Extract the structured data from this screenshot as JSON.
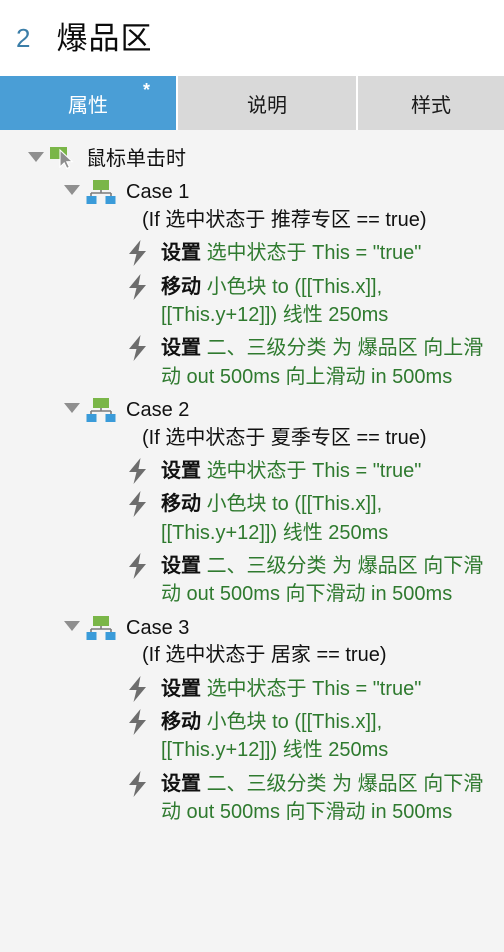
{
  "header": {
    "index": "2",
    "title": "爆品区"
  },
  "tabs": [
    {
      "label": "属性",
      "active": true,
      "dirty_marker": "*"
    },
    {
      "label": "说明",
      "active": false,
      "dirty_marker": ""
    },
    {
      "label": "样式",
      "active": false,
      "dirty_marker": ""
    }
  ],
  "tree": {
    "root": {
      "icon": "mouse-click-icon",
      "label": "鼠标单击时",
      "expanded": true
    },
    "cases": [
      {
        "icon": "case-branch-icon",
        "title": "Case 1",
        "condition": "(If 选中状态于 推荐专区 == true)",
        "expanded": true,
        "actions": [
          {
            "icon": "lightning-icon",
            "verb": "设置",
            "param": "选中状态于 This = \"true\""
          },
          {
            "icon": "lightning-icon",
            "verb": "移动",
            "param": "小色块 to ([[This.x]], [[This.y+12]]) 线性 250ms"
          },
          {
            "icon": "lightning-icon",
            "verb": "设置",
            "param": "二、三级分类 为 爆品区 向上滑动 out 500ms 向上滑动 in 500ms"
          }
        ]
      },
      {
        "icon": "case-branch-icon",
        "title": "Case 2",
        "condition": "(If 选中状态于 夏季专区 == true)",
        "expanded": true,
        "actions": [
          {
            "icon": "lightning-icon",
            "verb": "设置",
            "param": "选中状态于 This = \"true\""
          },
          {
            "icon": "lightning-icon",
            "verb": "移动",
            "param": "小色块 to ([[This.x]], [[This.y+12]]) 线性 250ms"
          },
          {
            "icon": "lightning-icon",
            "verb": "设置",
            "param": "二、三级分类 为 爆品区 向下滑动 out 500ms 向下滑动 in 500ms"
          }
        ]
      },
      {
        "icon": "case-branch-icon",
        "title": "Case 3",
        "condition": "(If 选中状态于 居家 == true)",
        "expanded": true,
        "actions": [
          {
            "icon": "lightning-icon",
            "verb": "设置",
            "param": "选中状态于 This = \"true\""
          },
          {
            "icon": "lightning-icon",
            "verb": "移动",
            "param": "小色块 to ([[This.x]], [[This.y+12]]) 线性 250ms"
          },
          {
            "icon": "lightning-icon",
            "verb": "设置",
            "param": "二、三级分类 为 爆品区 向下滑动 out 500ms 向下滑动 in 500ms"
          }
        ]
      }
    ]
  },
  "colors": {
    "accent_blue": "#4a9ed6",
    "index_blue": "#3b7ea8",
    "param_green": "#2f7a2f",
    "tab_inactive": "#d9d9d9",
    "tree_bg": "#f4f4f4",
    "icon_grey": "#6d6d6d",
    "icon_green": "#7ab648",
    "icon_blue": "#3a9bd9"
  }
}
